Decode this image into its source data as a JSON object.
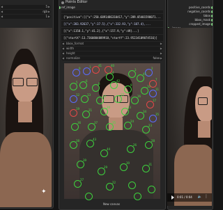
{
  "left_node": {
    "rows": [
      {
        "label": "",
        "value": "5"
      },
      {
        "label": "",
        "value": "rgb"
      },
      {
        "label": "",
        "value": "1"
      }
    ]
  },
  "mid_node": {
    "title": "Points Editor",
    "input_label": "ref_image",
    "points_store": "{\"positive\":[{\"x\":250.6891486310417,\"y\":289.05401598071...",
    "coordinates": "[{\"x\":283.92637,\"y\":37.5},{\"x\":332.93,\"y\":187.4},...",
    "neg_coordinates": "[{\"x\":1158.1,\"y\":41.2},{\"x\":157.9,\"y\":49}...]",
    "bbox_store": "bbox_store",
    "bboxes": "[{\"startX\":13.7360884889918,\"startY\":23.95234109074516}]",
    "rows": [
      {
        "label": "bbox_format",
        "value": ""
      },
      {
        "label": "width",
        "value": ""
      },
      {
        "label": "height",
        "value": ""
      },
      {
        "label": "normalize",
        "value": "false"
      }
    ],
    "points_labels": [
      "41",
      "40",
      "1",
      "0",
      "2",
      "3",
      "4",
      "45",
      "7",
      "5",
      "6",
      "8",
      "42",
      "9",
      "10",
      "11",
      "12",
      "13",
      "14",
      "15",
      "16",
      "17",
      "19",
      "21",
      "20",
      "33",
      "34",
      "35",
      "36",
      "37",
      "25",
      "24",
      "23",
      "38",
      "43",
      "44",
      "26",
      "28",
      "39",
      "29",
      "30",
      "31",
      "27",
      "22"
    ],
    "caption": "New canvas"
  },
  "right_node": {
    "outputs": [
      {
        "label": "positive_coords"
      },
      {
        "label": "negative_coords"
      },
      {
        "label": "bbox"
      },
      {
        "label": "bbox_mask"
      },
      {
        "label": "cropped_image"
      }
    ],
    "input_label": "image",
    "fields": [
      "",
      "",
      "",
      ""
    ],
    "video_time": "0:01 / 0:04"
  },
  "colors": {
    "positive_point": "#3ed23e",
    "negative_point": "#e44848",
    "bbox_point": "#5a6cff",
    "port": "#7fd07f"
  }
}
